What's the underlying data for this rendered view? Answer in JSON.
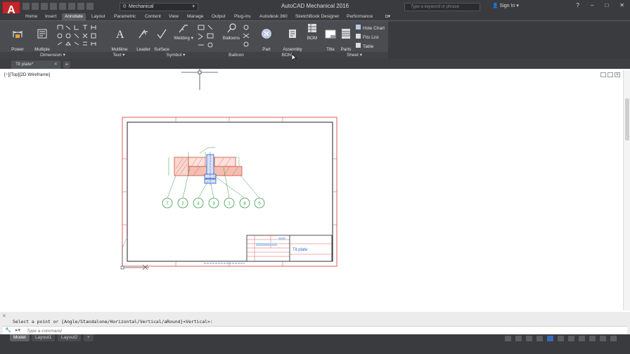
{
  "app": {
    "logo": "A",
    "title": "AutoCAD Mechanical 2016",
    "workspace": "Mechanical",
    "search_placeholder": "Type a keyword or phrase",
    "sign_in": "Sign In"
  },
  "ribbon_tabs": [
    {
      "label": "Home"
    },
    {
      "label": "Insert"
    },
    {
      "label": "Annotate"
    },
    {
      "label": "Layout"
    },
    {
      "label": "Parametric"
    },
    {
      "label": "Content"
    },
    {
      "label": "View"
    },
    {
      "label": "Manage"
    },
    {
      "label": "Output"
    },
    {
      "label": "Plug-ins"
    },
    {
      "label": "Autodesk 360"
    },
    {
      "label": "SketchBook Designer"
    },
    {
      "label": "Performance"
    }
  ],
  "ribbon": {
    "power_dim": "Power\nDimension",
    "multi_dim": "Multiple\nDimension",
    "multiline_text": "Multiline\nText",
    "leader_note": "Leader\nNote",
    "surface_texture": "Surface\nTexture",
    "welding": "Welding",
    "balloons": "Balloons",
    "part_reference": "Part\nReference",
    "assembly_properties": "Assembly\nProperties",
    "bom": "BOM",
    "title_border": "Title\nBorder",
    "parts_list": "Parts\nList",
    "hole_chart": "Hole Chart",
    "fits_list": "Fits List",
    "table": "Table",
    "panels": {
      "dimension": "Dimension",
      "text": "Text",
      "symbol": "Symbol",
      "balloon": "Balloon",
      "bom": "BOM",
      "sheet": "Sheet"
    }
  },
  "document": {
    "tab_label": "Tit plate*"
  },
  "viewport": {
    "label": "[−][Top][2D Wireframe]"
  },
  "drawing": {
    "balloons": [
      "7",
      "2",
      "4",
      "3",
      "1",
      "8",
      "5"
    ],
    "title_block_text": "Tit plate"
  },
  "command": {
    "history": "Select a point or [Angle/Standalone/Horizontal/Vertical/aRound]<Vertical>:",
    "placeholder": "Type a command"
  },
  "layout_tabs": [
    {
      "label": "Model",
      "active": true
    },
    {
      "label": "Layout1",
      "active": false
    },
    {
      "label": "Layout2",
      "active": false
    }
  ],
  "colors": {
    "app_red": "#c0262b",
    "ribbon_bg": "#4a4c50",
    "title_bg": "#3a3b3e",
    "border_red": "#e05a5a",
    "annotation_green": "#3a9a4a",
    "part_red": "#d94a3a",
    "hatch_blue": "#2a5ac8"
  }
}
